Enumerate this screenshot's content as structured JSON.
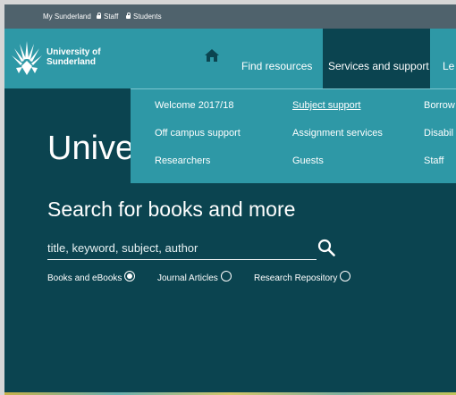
{
  "topbar": {
    "links": [
      {
        "label": "My Sunderland"
      },
      {
        "label": "Staff"
      },
      {
        "label": "Students"
      }
    ]
  },
  "logo": {
    "line1": "University of",
    "line2": "Sunderland"
  },
  "nav": {
    "home_icon": "home-icon",
    "items": [
      {
        "label": "Find resources"
      },
      {
        "label": "Services and support",
        "active": true
      },
      {
        "label": "Le"
      }
    ]
  },
  "dropdown": {
    "col1": [
      "Welcome 2017/18",
      "Off campus support",
      "Researchers"
    ],
    "col2": [
      "Subject support",
      "Assignment services",
      "Guests"
    ],
    "col3": [
      "Borrow",
      "Disabil",
      "Staff"
    ]
  },
  "hero": {
    "title": "Unive"
  },
  "search": {
    "title": "Search for books and more",
    "placeholder": "title, keyword, subject, author",
    "button_icon": "search-icon",
    "options": [
      {
        "label": "Books and eBooks",
        "selected": true
      },
      {
        "label": "Journal Articles",
        "selected": false
      },
      {
        "label": "Research Repository",
        "selected": false
      }
    ]
  },
  "colors": {
    "teal": "#2e98a6",
    "dark_teal": "#0b4450",
    "topbar": "#4f626c"
  }
}
